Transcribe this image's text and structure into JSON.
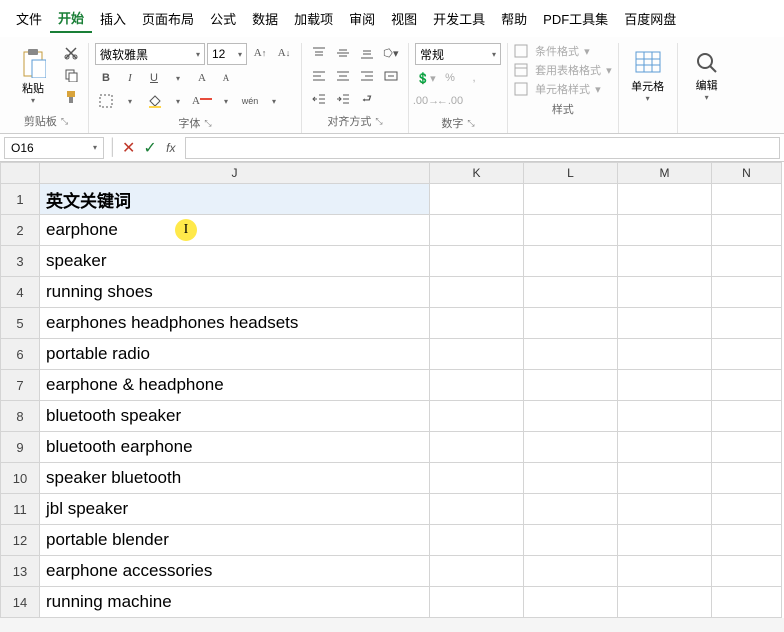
{
  "menu": [
    "文件",
    "开始",
    "插入",
    "页面布局",
    "公式",
    "数据",
    "加载项",
    "审阅",
    "视图",
    "开发工具",
    "帮助",
    "PDF工具集",
    "百度网盘"
  ],
  "active_menu_index": 1,
  "ribbon": {
    "clipboard": {
      "paste": "粘贴",
      "label": "剪贴板"
    },
    "font": {
      "name": "微软雅黑",
      "size": "12",
      "label": "字体",
      "bold": "B",
      "italic": "I",
      "underline": "U"
    },
    "align": {
      "label": "对齐方式"
    },
    "number": {
      "format": "常规",
      "label": "数字"
    },
    "styles": {
      "cond": "条件格式",
      "tblfmt": "套用表格格式",
      "cellstyle": "单元格样式",
      "label": "样式"
    },
    "cells": {
      "label": "单元格"
    },
    "editing": {
      "label": "编辑"
    }
  },
  "namebox": "O16",
  "formula": "",
  "columns": [
    "J",
    "K",
    "L",
    "M",
    "N"
  ],
  "rows": [
    {
      "n": 1,
      "j": "英文关键词",
      "header": true
    },
    {
      "n": 2,
      "j": "earphone"
    },
    {
      "n": 3,
      "j": "speaker"
    },
    {
      "n": 4,
      "j": "running shoes"
    },
    {
      "n": 5,
      "j": "earphones headphones headsets"
    },
    {
      "n": 6,
      "j": "portable radio"
    },
    {
      "n": 7,
      "j": "earphone & headphone"
    },
    {
      "n": 8,
      "j": "bluetooth speaker"
    },
    {
      "n": 9,
      "j": "bluetooth earphone"
    },
    {
      "n": 10,
      "j": "speaker bluetooth"
    },
    {
      "n": 11,
      "j": "jbl speaker"
    },
    {
      "n": 12,
      "j": "portable blender"
    },
    {
      "n": 13,
      "j": "earphone accessories"
    },
    {
      "n": 14,
      "j": "running machine"
    }
  ],
  "cursor": {
    "row_index": 1,
    "glyph": "I"
  }
}
